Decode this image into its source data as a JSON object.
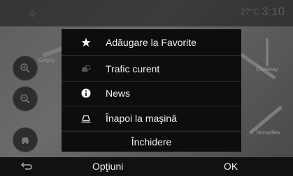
{
  "status": {
    "temperature": "27°C",
    "time": "3:10"
  },
  "map": {
    "place_left": "Grigny",
    "place_right_top": "Chesnay",
    "place_right_bottom": "Versailles"
  },
  "menu": {
    "items": [
      {
        "label": "Adăugare la Favorite",
        "icon": "star-icon"
      },
      {
        "label": "Trafic curent",
        "icon": "traffic-icon"
      },
      {
        "label": "News",
        "icon": "info-icon"
      },
      {
        "label": "Înapoi la maşină",
        "icon": "car-icon"
      }
    ],
    "close_label": "Închidere"
  },
  "bottom": {
    "left_label": "Opţiuni",
    "right_label": "OK"
  },
  "colors": {
    "menu_bg": "#0d0d0d",
    "text": "#f0f0f0"
  }
}
